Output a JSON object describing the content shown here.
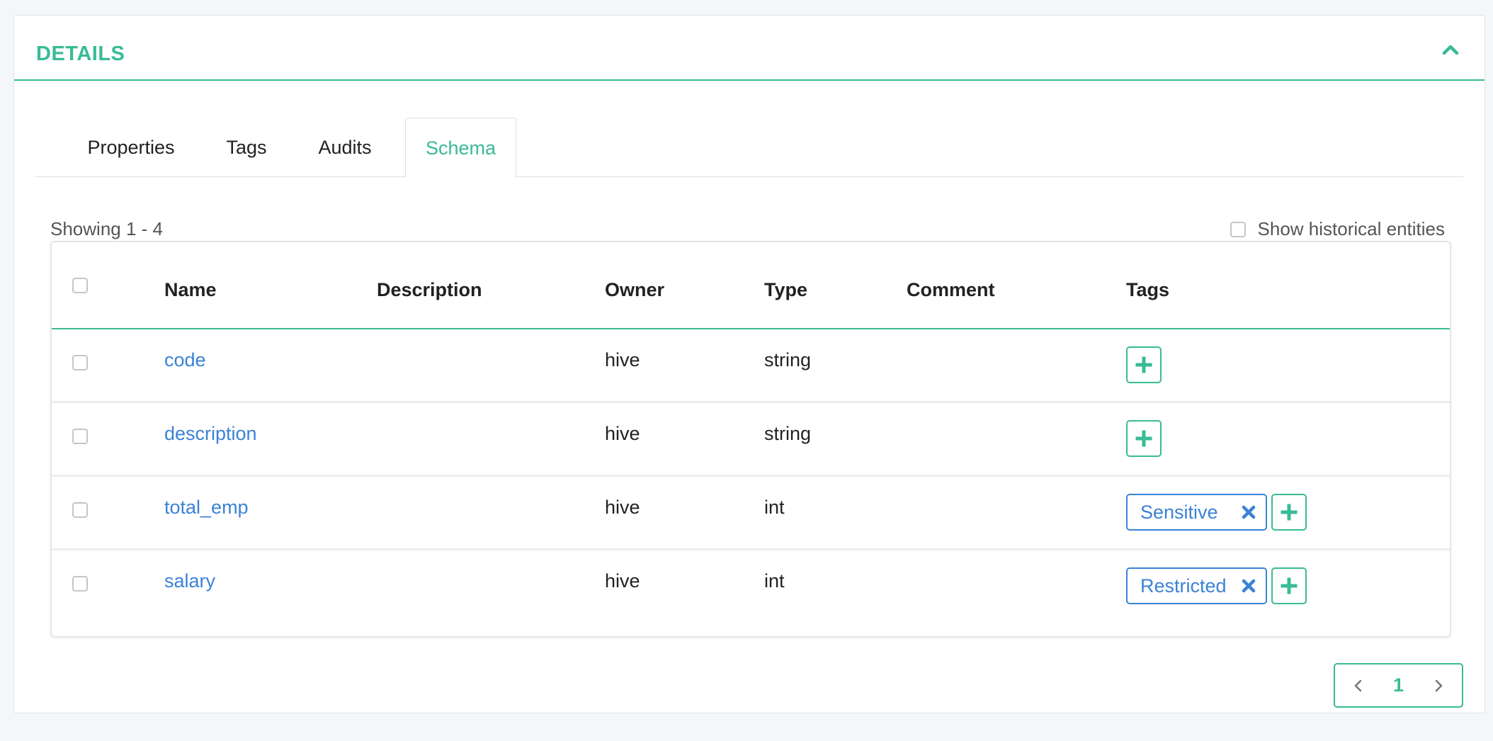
{
  "panel": {
    "title": "DETAILS"
  },
  "tabs": [
    {
      "label": "Properties"
    },
    {
      "label": "Tags"
    },
    {
      "label": "Audits"
    },
    {
      "label": "Schema",
      "active": true
    }
  ],
  "toolbar": {
    "showing": "Showing 1 - 4",
    "historical_label": "Show historical entities"
  },
  "table": {
    "columns": [
      "Name",
      "Description",
      "Owner",
      "Type",
      "Comment",
      "Tags"
    ],
    "rows": [
      {
        "name": "code",
        "description": "",
        "owner": "hive",
        "type": "string",
        "comment": "",
        "tags": []
      },
      {
        "name": "description",
        "description": "",
        "owner": "hive",
        "type": "string",
        "comment": "",
        "tags": []
      },
      {
        "name": "total_emp",
        "description": "",
        "owner": "hive",
        "type": "int",
        "comment": "",
        "tags": [
          "Sensitive"
        ]
      },
      {
        "name": "salary",
        "description": "",
        "owner": "hive",
        "type": "int",
        "comment": "",
        "tags": [
          "Restricted"
        ]
      }
    ]
  },
  "pagination": {
    "current_page": "1"
  },
  "icons": {
    "collapse": "chevron-up-icon",
    "add": "plus-icon",
    "remove": "close-icon",
    "prev": "chevron-left-icon",
    "next": "chevron-right-icon"
  },
  "colors": {
    "accent": "#38bb96",
    "link": "#3b82d6"
  }
}
